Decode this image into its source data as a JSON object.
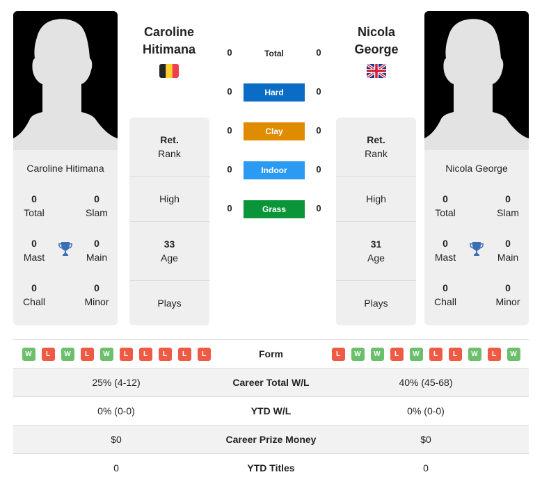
{
  "players": {
    "left": {
      "name": "Caroline Hitimana",
      "name_line1": "Caroline",
      "name_line2": "Hitimana",
      "flag": "belgium-flag",
      "titles": {
        "total": {
          "value": "0",
          "label": "Total"
        },
        "slam": {
          "value": "0",
          "label": "Slam"
        },
        "mast": {
          "value": "0",
          "label": "Mast"
        },
        "main": {
          "value": "0",
          "label": "Main"
        },
        "chall": {
          "value": "0",
          "label": "Chall"
        },
        "minor": {
          "value": "0",
          "label": "Minor"
        }
      },
      "info": {
        "rank": {
          "value": "Ret.",
          "label": "Rank"
        },
        "high": {
          "value": "",
          "label": "High"
        },
        "age": {
          "value": "33",
          "label": "Age"
        },
        "plays": {
          "value": "",
          "label": "Plays"
        }
      },
      "form": [
        "W",
        "L",
        "W",
        "L",
        "W",
        "L",
        "L",
        "L",
        "L",
        "L"
      ]
    },
    "right": {
      "name": "Nicola George",
      "name_line1": "Nicola",
      "name_line2": "George",
      "flag": "uk-flag",
      "titles": {
        "total": {
          "value": "0",
          "label": "Total"
        },
        "slam": {
          "value": "0",
          "label": "Slam"
        },
        "mast": {
          "value": "0",
          "label": "Mast"
        },
        "main": {
          "value": "0",
          "label": "Main"
        },
        "chall": {
          "value": "0",
          "label": "Chall"
        },
        "minor": {
          "value": "0",
          "label": "Minor"
        }
      },
      "info": {
        "rank": {
          "value": "Ret.",
          "label": "Rank"
        },
        "high": {
          "value": "",
          "label": "High"
        },
        "age": {
          "value": "31",
          "label": "Age"
        },
        "plays": {
          "value": "",
          "label": "Plays"
        }
      },
      "form": [
        "L",
        "W",
        "W",
        "L",
        "W",
        "L",
        "L",
        "W",
        "L",
        "W"
      ]
    }
  },
  "h2h": [
    {
      "surface": "Total",
      "left": "0",
      "right": "0",
      "color": ""
    },
    {
      "surface": "Hard",
      "left": "0",
      "right": "0",
      "color": "#0a6cc4"
    },
    {
      "surface": "Clay",
      "left": "0",
      "right": "0",
      "color": "#e08c00"
    },
    {
      "surface": "Indoor",
      "left": "0",
      "right": "0",
      "color": "#2b9af3"
    },
    {
      "surface": "Grass",
      "left": "0",
      "right": "0",
      "color": "#0a9638"
    }
  ],
  "comparison": {
    "form_label": "Form",
    "rows": [
      {
        "label": "Career Total W/L",
        "left": "25% (4-12)",
        "right": "40% (45-68)"
      },
      {
        "label": "YTD W/L",
        "left": "0% (0-0)",
        "right": "0% (0-0)"
      },
      {
        "label": "Career Prize Money",
        "left": "$0",
        "right": "$0"
      },
      {
        "label": "YTD Titles",
        "left": "0",
        "right": "0"
      }
    ]
  },
  "colors": {
    "win": "#6cbf6c",
    "loss": "#ee5b45",
    "trophy": "#3b6fb6"
  }
}
